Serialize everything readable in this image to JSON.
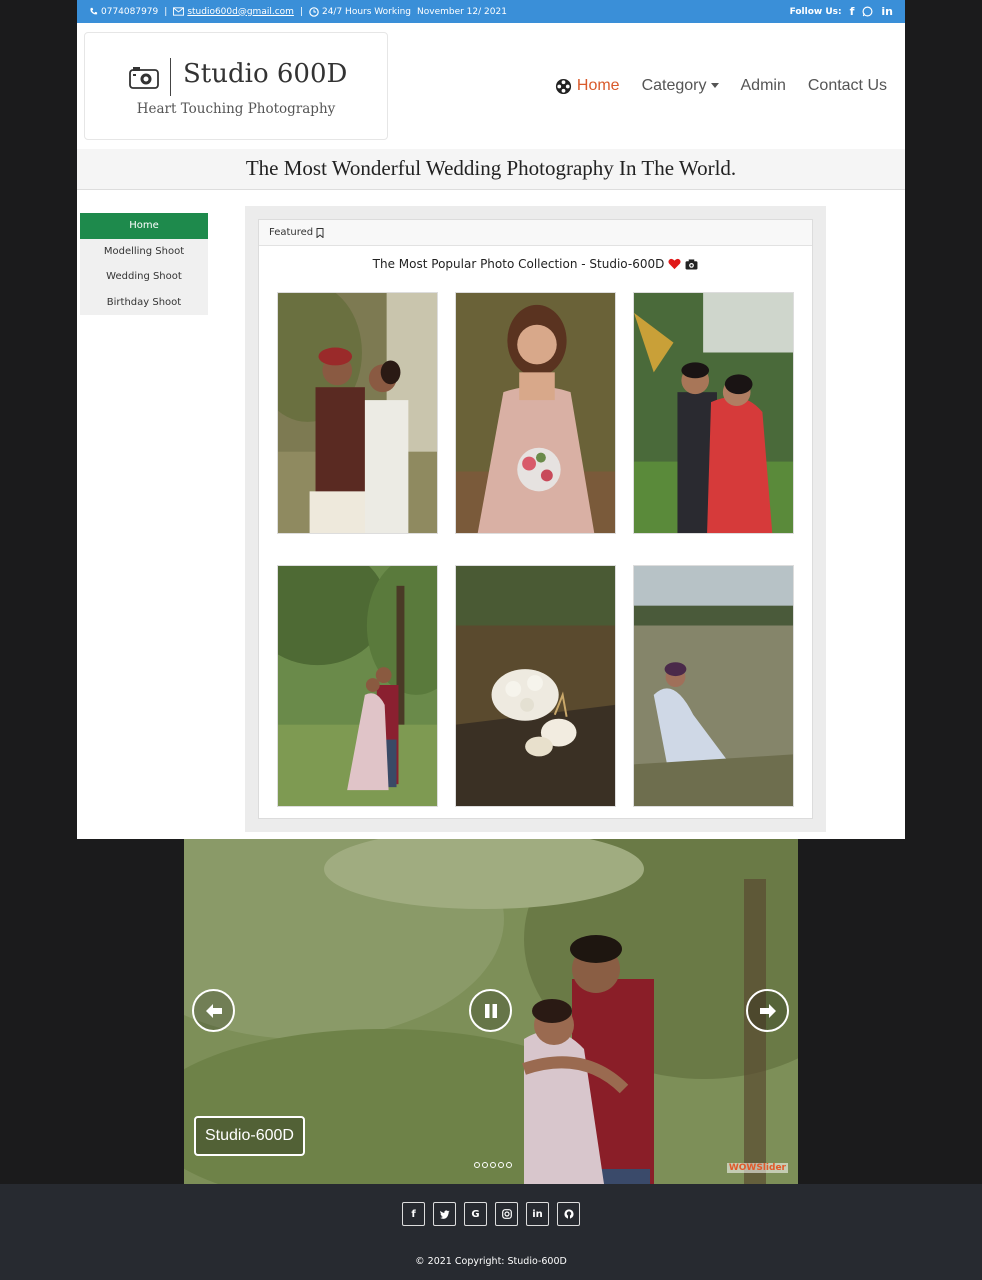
{
  "topbar": {
    "phone": "0774087979",
    "email": "studio600d@gmail.com",
    "hours": "24/7 Hours Working",
    "date": "November 12/ 2021",
    "follow": "Follow Us:",
    "socials": [
      "facebook-icon",
      "whatsapp-icon",
      "linkedin-icon"
    ]
  },
  "logo": {
    "title": "Studio 600D",
    "tagline": "Heart Touching Photography"
  },
  "nav": {
    "home": "Home",
    "category": "Category",
    "admin": "Admin",
    "contact": "Contact Us",
    "active_color": "#d95a2b"
  },
  "banner": {
    "text": "The Most Wonderful Wedding Photography In The World."
  },
  "sidebar": {
    "items": [
      {
        "label": "Home",
        "active": true
      },
      {
        "label": "Modelling Shoot"
      },
      {
        "label": "Wedding Shoot"
      },
      {
        "label": "Birthday Shoot"
      }
    ],
    "active_color": "#1e8a4c"
  },
  "gallery": {
    "header": "Featured",
    "title": "The Most Popular Photo Collection - Studio-600D",
    "photos": [
      "couple-traditional-wedding",
      "bride-pink-gown",
      "couple-red-saree",
      "couple-garden-embrace",
      "bridal-bouquet-shoes",
      "woman-in-field"
    ]
  },
  "slider": {
    "caption": "Studio-600D",
    "watermark": "WOWSlider",
    "dots": 5
  },
  "footer": {
    "socials": [
      "facebook-icon",
      "twitter-icon",
      "google-icon",
      "instagram-icon",
      "linkedin-icon",
      "github-icon"
    ],
    "copyright": "© 2021 Copyright: Studio-600D"
  },
  "colors": {
    "topbar": "#3a8fd8",
    "footer": "#272a30",
    "page_bg": "#1b1b1c"
  }
}
